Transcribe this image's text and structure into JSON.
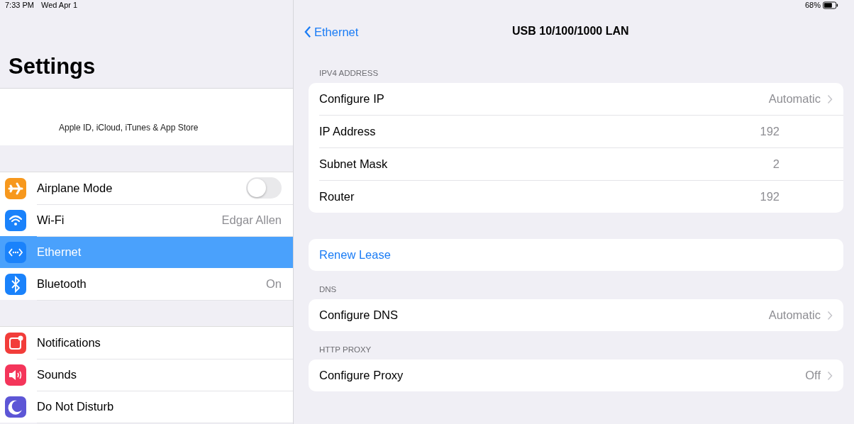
{
  "status_bar": {
    "time": "7:33 PM",
    "date": "Wed Apr 1",
    "battery": "68%"
  },
  "sidebar": {
    "title": "Settings",
    "profile": {
      "caption": "Apple ID, iCloud, iTunes & App Store"
    },
    "groups": [
      [
        {
          "label": "Airplane Mode",
          "kind": "toggle",
          "on": false,
          "selected": false,
          "color": "#f7981d"
        },
        {
          "label": "Wi-Fi",
          "kind": "value",
          "value": "Edgar Allen",
          "selected": false,
          "color": "#1a82fb"
        },
        {
          "label": "Ethernet",
          "kind": "plain",
          "selected": true,
          "color": "#1a82fb"
        },
        {
          "label": "Bluetooth",
          "kind": "value",
          "value": "On",
          "selected": false,
          "color": "#1a82fb"
        }
      ],
      [
        {
          "label": "Notifications",
          "kind": "plain",
          "selected": false,
          "color": "#f23d3a"
        },
        {
          "label": "Sounds",
          "kind": "plain",
          "selected": false,
          "color": "#f4355a"
        },
        {
          "label": "Do Not Disturb",
          "kind": "plain",
          "selected": false,
          "color": "#5d56d6"
        }
      ]
    ]
  },
  "detail": {
    "back": "Ethernet",
    "title": "USB 10/100/1000 LAN",
    "sections": [
      {
        "header": "IPV4 ADDRESS",
        "rows": [
          {
            "kind": "disclosure",
            "label": "Configure IP",
            "value": "Automatic"
          },
          {
            "kind": "value",
            "label": "IP Address",
            "value": "192"
          },
          {
            "kind": "value",
            "label": "Subnet Mask",
            "value": "2"
          },
          {
            "kind": "value",
            "label": "Router",
            "value": "192"
          }
        ]
      },
      {
        "rows": [
          {
            "kind": "link",
            "label": "Renew Lease"
          }
        ]
      },
      {
        "header": "DNS",
        "rows": [
          {
            "kind": "disclosure",
            "label": "Configure DNS",
            "value": "Automatic"
          }
        ]
      },
      {
        "header": "HTTP PROXY",
        "rows": [
          {
            "kind": "disclosure",
            "label": "Configure Proxy",
            "value": "Off"
          }
        ]
      }
    ]
  }
}
